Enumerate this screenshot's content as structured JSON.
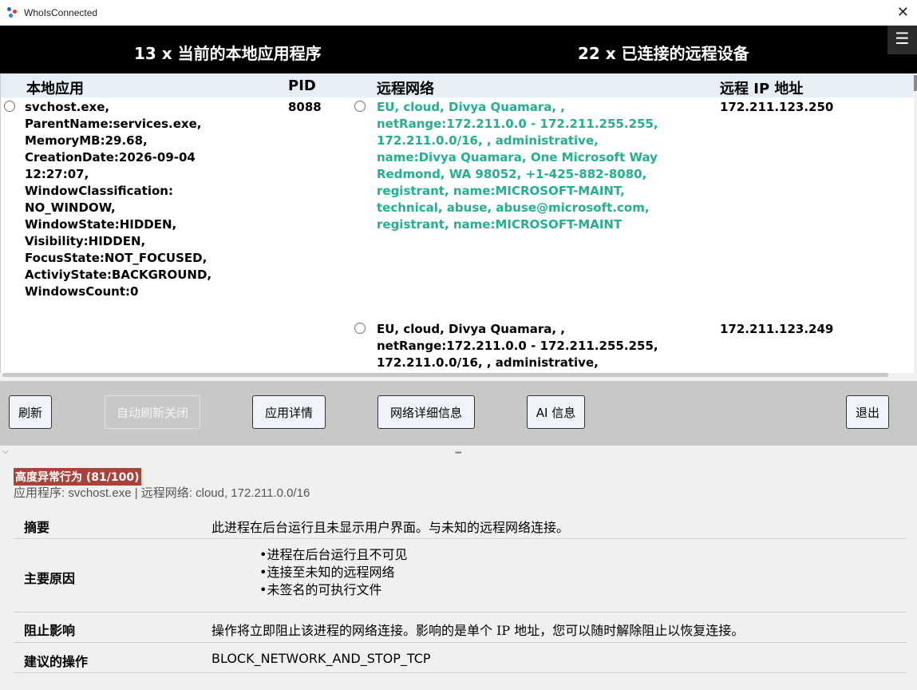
{
  "window": {
    "title": "WhoIsConnected"
  },
  "header": {
    "local_apps": "13 x 当前的本地应用程序",
    "remote_devices": "22 x 已连接的远程设备",
    "menu_icon": "hamburger-menu-icon"
  },
  "table": {
    "columns": [
      "本地应用",
      "PID",
      "远程网络",
      "远程 IP 地址"
    ],
    "rows": [
      {
        "app_lines": [
          "svchost.exe,",
          "ParentName:services.exe,",
          "MemoryMB:29.68,",
          "CreationDate:2026-09-04",
          "12:27:07,",
          "WindowClassification:",
          "NO_WINDOW,",
          "WindowState:HIDDEN,",
          "Visibility:HIDDEN,",
          "FocusState:NOT_FOCUSED,",
          "ActiviyState:BACKGROUND,",
          "WindowsCount:0"
        ],
        "pid": "8088",
        "network_lines": [
          "EU, cloud, Divya Quamara, ,",
          "netRange:172.211.0.0 - 172.211.255.255,",
          "172.211.0.0/16, , administrative,",
          "name:Divya Quamara, One Microsoft Way",
          "Redmond, WA 98052, +1-425-882-8080,",
          "registrant, name:MICROSOFT-MAINT,",
          "technical, abuse, abuse@microsoft.com,",
          "registrant, name:MICROSOFT-MAINT"
        ],
        "network_color": "#22b08f",
        "ip": "172.211.123.250"
      },
      {
        "network_lines": [
          "EU, cloud, Divya Quamara, ,",
          "netRange:172.211.0.0 - 172.211.255.255,",
          "172.211.0.0/16, , administrative,"
        ],
        "ip": "172.211.123.249"
      }
    ]
  },
  "toolbar": {
    "refresh": "刷新",
    "auto_refresh_off": "自动刷新关闭",
    "app_details": "应用详情",
    "network_details": "网络详细信息",
    "ai_info": "AI 信息",
    "exit": "退出"
  },
  "detail": {
    "badge": "高度异常行为 (81/100)",
    "badge_color": "#a8433b",
    "subtitle": "应用程序: svchost.exe | 远程网络: cloud, 172.211.0.0/16",
    "summary_label": "摘要",
    "summary": "此进程在后台运行且未显示用户界面。与未知的远程网络连接。",
    "reasons_label": "主要原因",
    "reasons": [
      "进程在后台运行且不可见",
      "连接至未知的远程网络",
      "未签名的可执行文件"
    ],
    "impact_label": "阻止影响",
    "impact": "操作将立即阻止该进程的网络连接。影响的是单个 IP 地址，您可以随时解除阻止以恢复连接。",
    "action_label": "建议的操作",
    "action": "BLOCK_NETWORK_AND_STOP_TCP"
  }
}
